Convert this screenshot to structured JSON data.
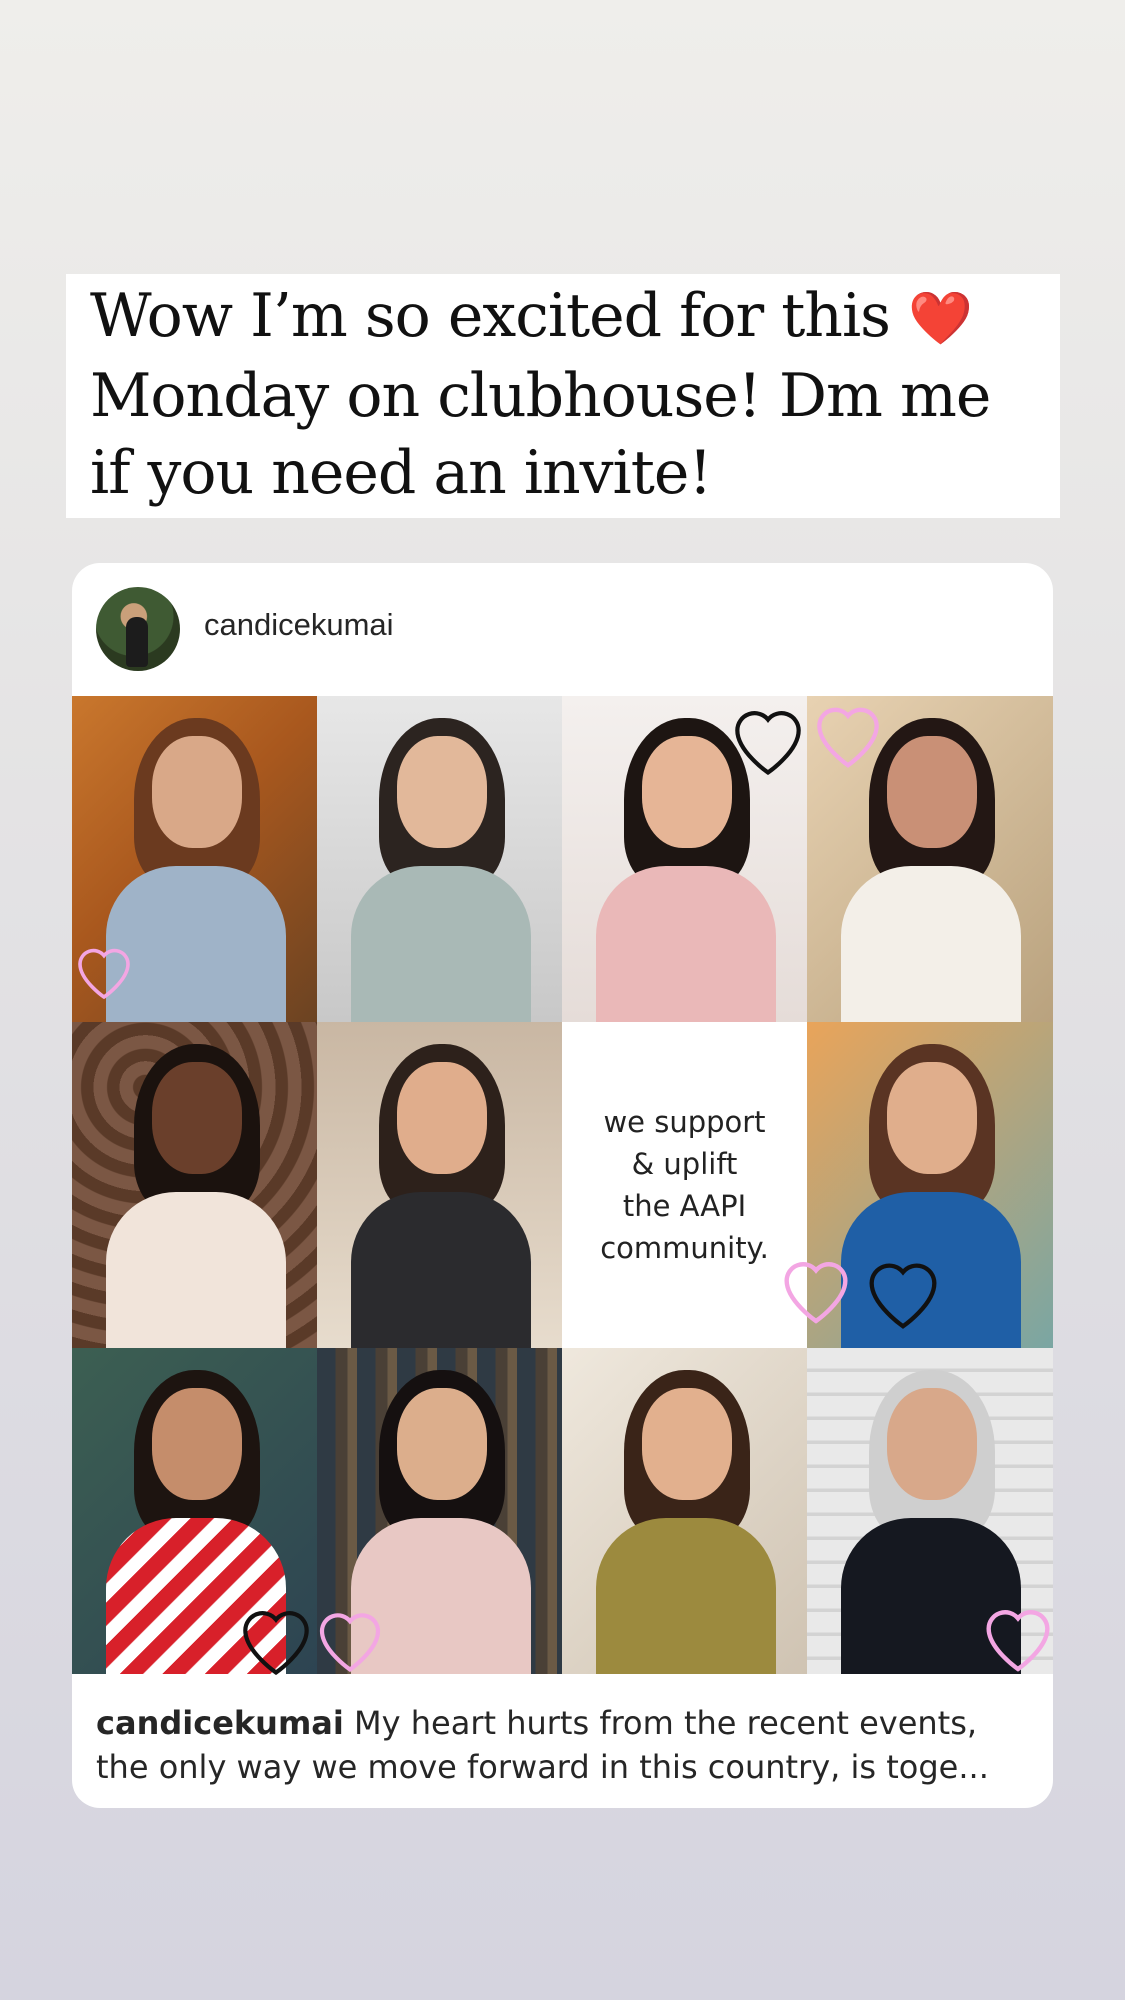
{
  "story": {
    "caption_text": "Wow I’m so excited for this",
    "caption_emoji": "❤️",
    "caption_text_rest": "Monday on clubhouse! Dm me if you need an invite!"
  },
  "post": {
    "username": "candicekumai",
    "caption_user": "candicekumai",
    "caption_body": "My heart hurts from the recent events, the only way we move forward in this country, is toge...",
    "center_tile_text": "we support\n& uplift\nthe AAPI\ncommunity.",
    "photos": [
      {
        "name": "photo-1"
      },
      {
        "name": "photo-2"
      },
      {
        "name": "photo-3"
      },
      {
        "name": "photo-4"
      },
      {
        "name": "photo-5"
      },
      {
        "name": "photo-6"
      },
      {
        "name": "photo-8"
      },
      {
        "name": "photo-9"
      },
      {
        "name": "photo-10"
      },
      {
        "name": "photo-11"
      },
      {
        "name": "photo-12"
      }
    ]
  },
  "colors": {
    "heart_red": "#d7141f",
    "heart_pink": "#f3a6e3",
    "heart_black": "#111111"
  }
}
